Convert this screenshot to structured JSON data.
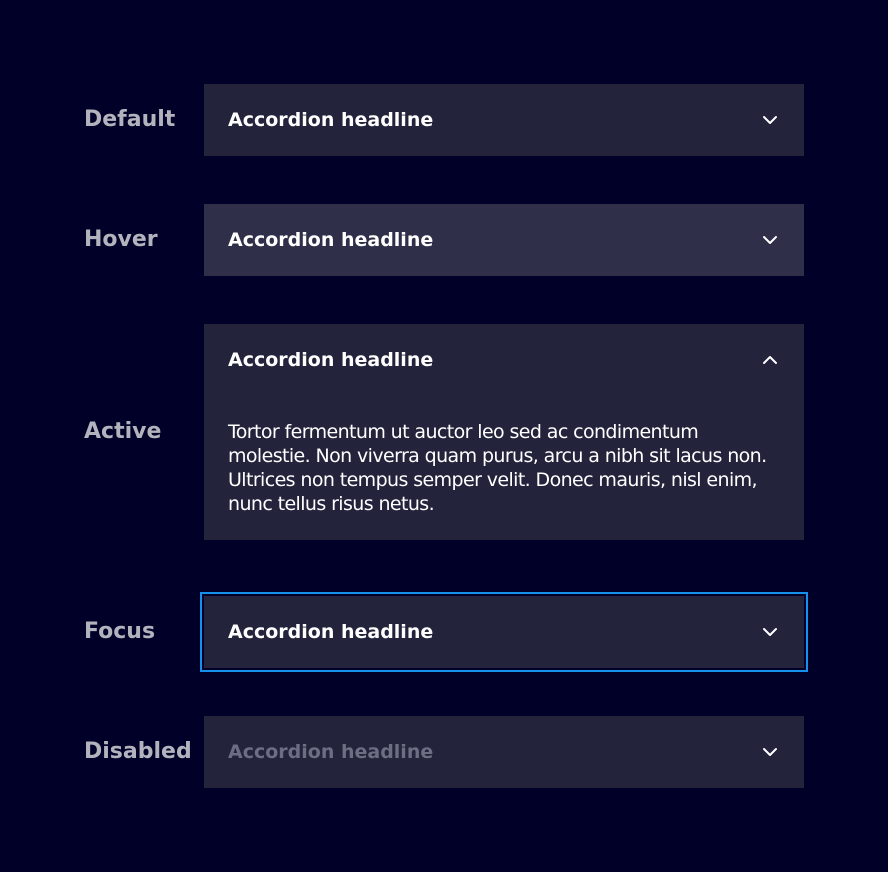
{
  "states": [
    {
      "id": "default",
      "label": "Default",
      "title": "Accordion headline",
      "expanded": false
    },
    {
      "id": "hover",
      "label": "Hover",
      "title": "Accordion headline",
      "expanded": false
    },
    {
      "id": "active",
      "label": "Active",
      "title": "Accordion headline",
      "expanded": true,
      "content": "Tortor fermentum ut auctor leo sed ac condimentum molestie. Non viverra quam purus, arcu a nibh sit lacus non. Ultrices non tempus semper velit. Donec mauris, nisl enim, nunc tellus risus netus."
    },
    {
      "id": "focus",
      "label": "Focus",
      "title": "Accordion headline",
      "expanded": false
    },
    {
      "id": "disabled",
      "label": "Disabled",
      "title": "Accordion headline",
      "expanded": false
    }
  ],
  "icons": {
    "collapsed": "chevron-down-icon",
    "expanded": "chevron-up-icon"
  },
  "colors": {
    "background": "#000028",
    "accordion": "#23233c",
    "accordion_hover": "#2f2f4a",
    "focus_outline": "#1491eb",
    "label": "#b3b3be",
    "title": "#ffffff",
    "title_disabled": "#6d6d83"
  }
}
